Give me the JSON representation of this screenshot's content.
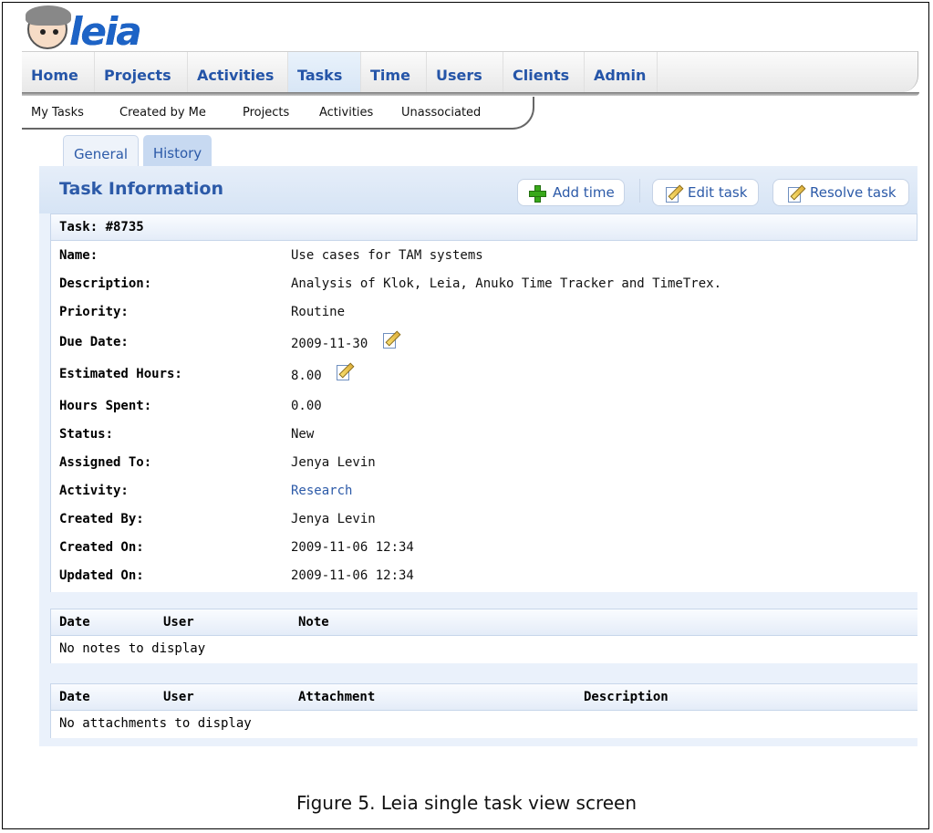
{
  "app": {
    "logo_text": "leia"
  },
  "main_nav": [
    "Home",
    "Projects",
    "Activities",
    "Tasks",
    "Time",
    "Users",
    "Clients",
    "Admin"
  ],
  "sub_nav": [
    "My Tasks",
    "Created by Me",
    "Projects",
    "Activities",
    "Unassociated"
  ],
  "tabs": [
    "General",
    "History"
  ],
  "panel": {
    "title": "Task Information",
    "buttons": {
      "add_time": "Add time",
      "edit_task": "Edit task",
      "resolve_task": "Resolve task"
    }
  },
  "task": {
    "header": "Task: #8735",
    "fields": [
      {
        "label": "Name:",
        "value": "Use cases for TAM systems"
      },
      {
        "label": "Description:",
        "value": "Analysis of Klok, Leia, Anuko Time Tracker and TimeTrex."
      },
      {
        "label": "Priority:",
        "value": "Routine"
      },
      {
        "label": "Due Date:",
        "value": "2009-11-30"
      },
      {
        "label": "Estimated Hours:",
        "value": "8.00"
      },
      {
        "label": "Hours Spent:",
        "value": "0.00"
      },
      {
        "label": "Status:",
        "value": "New"
      },
      {
        "label": "Assigned To:",
        "value": "Jenya Levin"
      },
      {
        "label": "Activity:",
        "value": "Research"
      },
      {
        "label": "Created By:",
        "value": "Jenya Levin"
      },
      {
        "label": "Created On:",
        "value": "2009-11-06 12:34"
      },
      {
        "label": "Updated On:",
        "value": "2009-11-06 12:34"
      }
    ]
  },
  "notes_table": {
    "columns": [
      "Date",
      "User",
      "Note"
    ],
    "empty": "No notes to display"
  },
  "attachments_table": {
    "columns": [
      "Date",
      "User",
      "Attachment",
      "Description"
    ],
    "empty": "No attachments to display"
  },
  "caption": "Figure 5. Leia single task view screen",
  "colors": {
    "accent": "#2c5aa8",
    "panel_bg": "#eaf1fb"
  },
  "icons": [
    "add-icon",
    "edit-icon"
  ]
}
